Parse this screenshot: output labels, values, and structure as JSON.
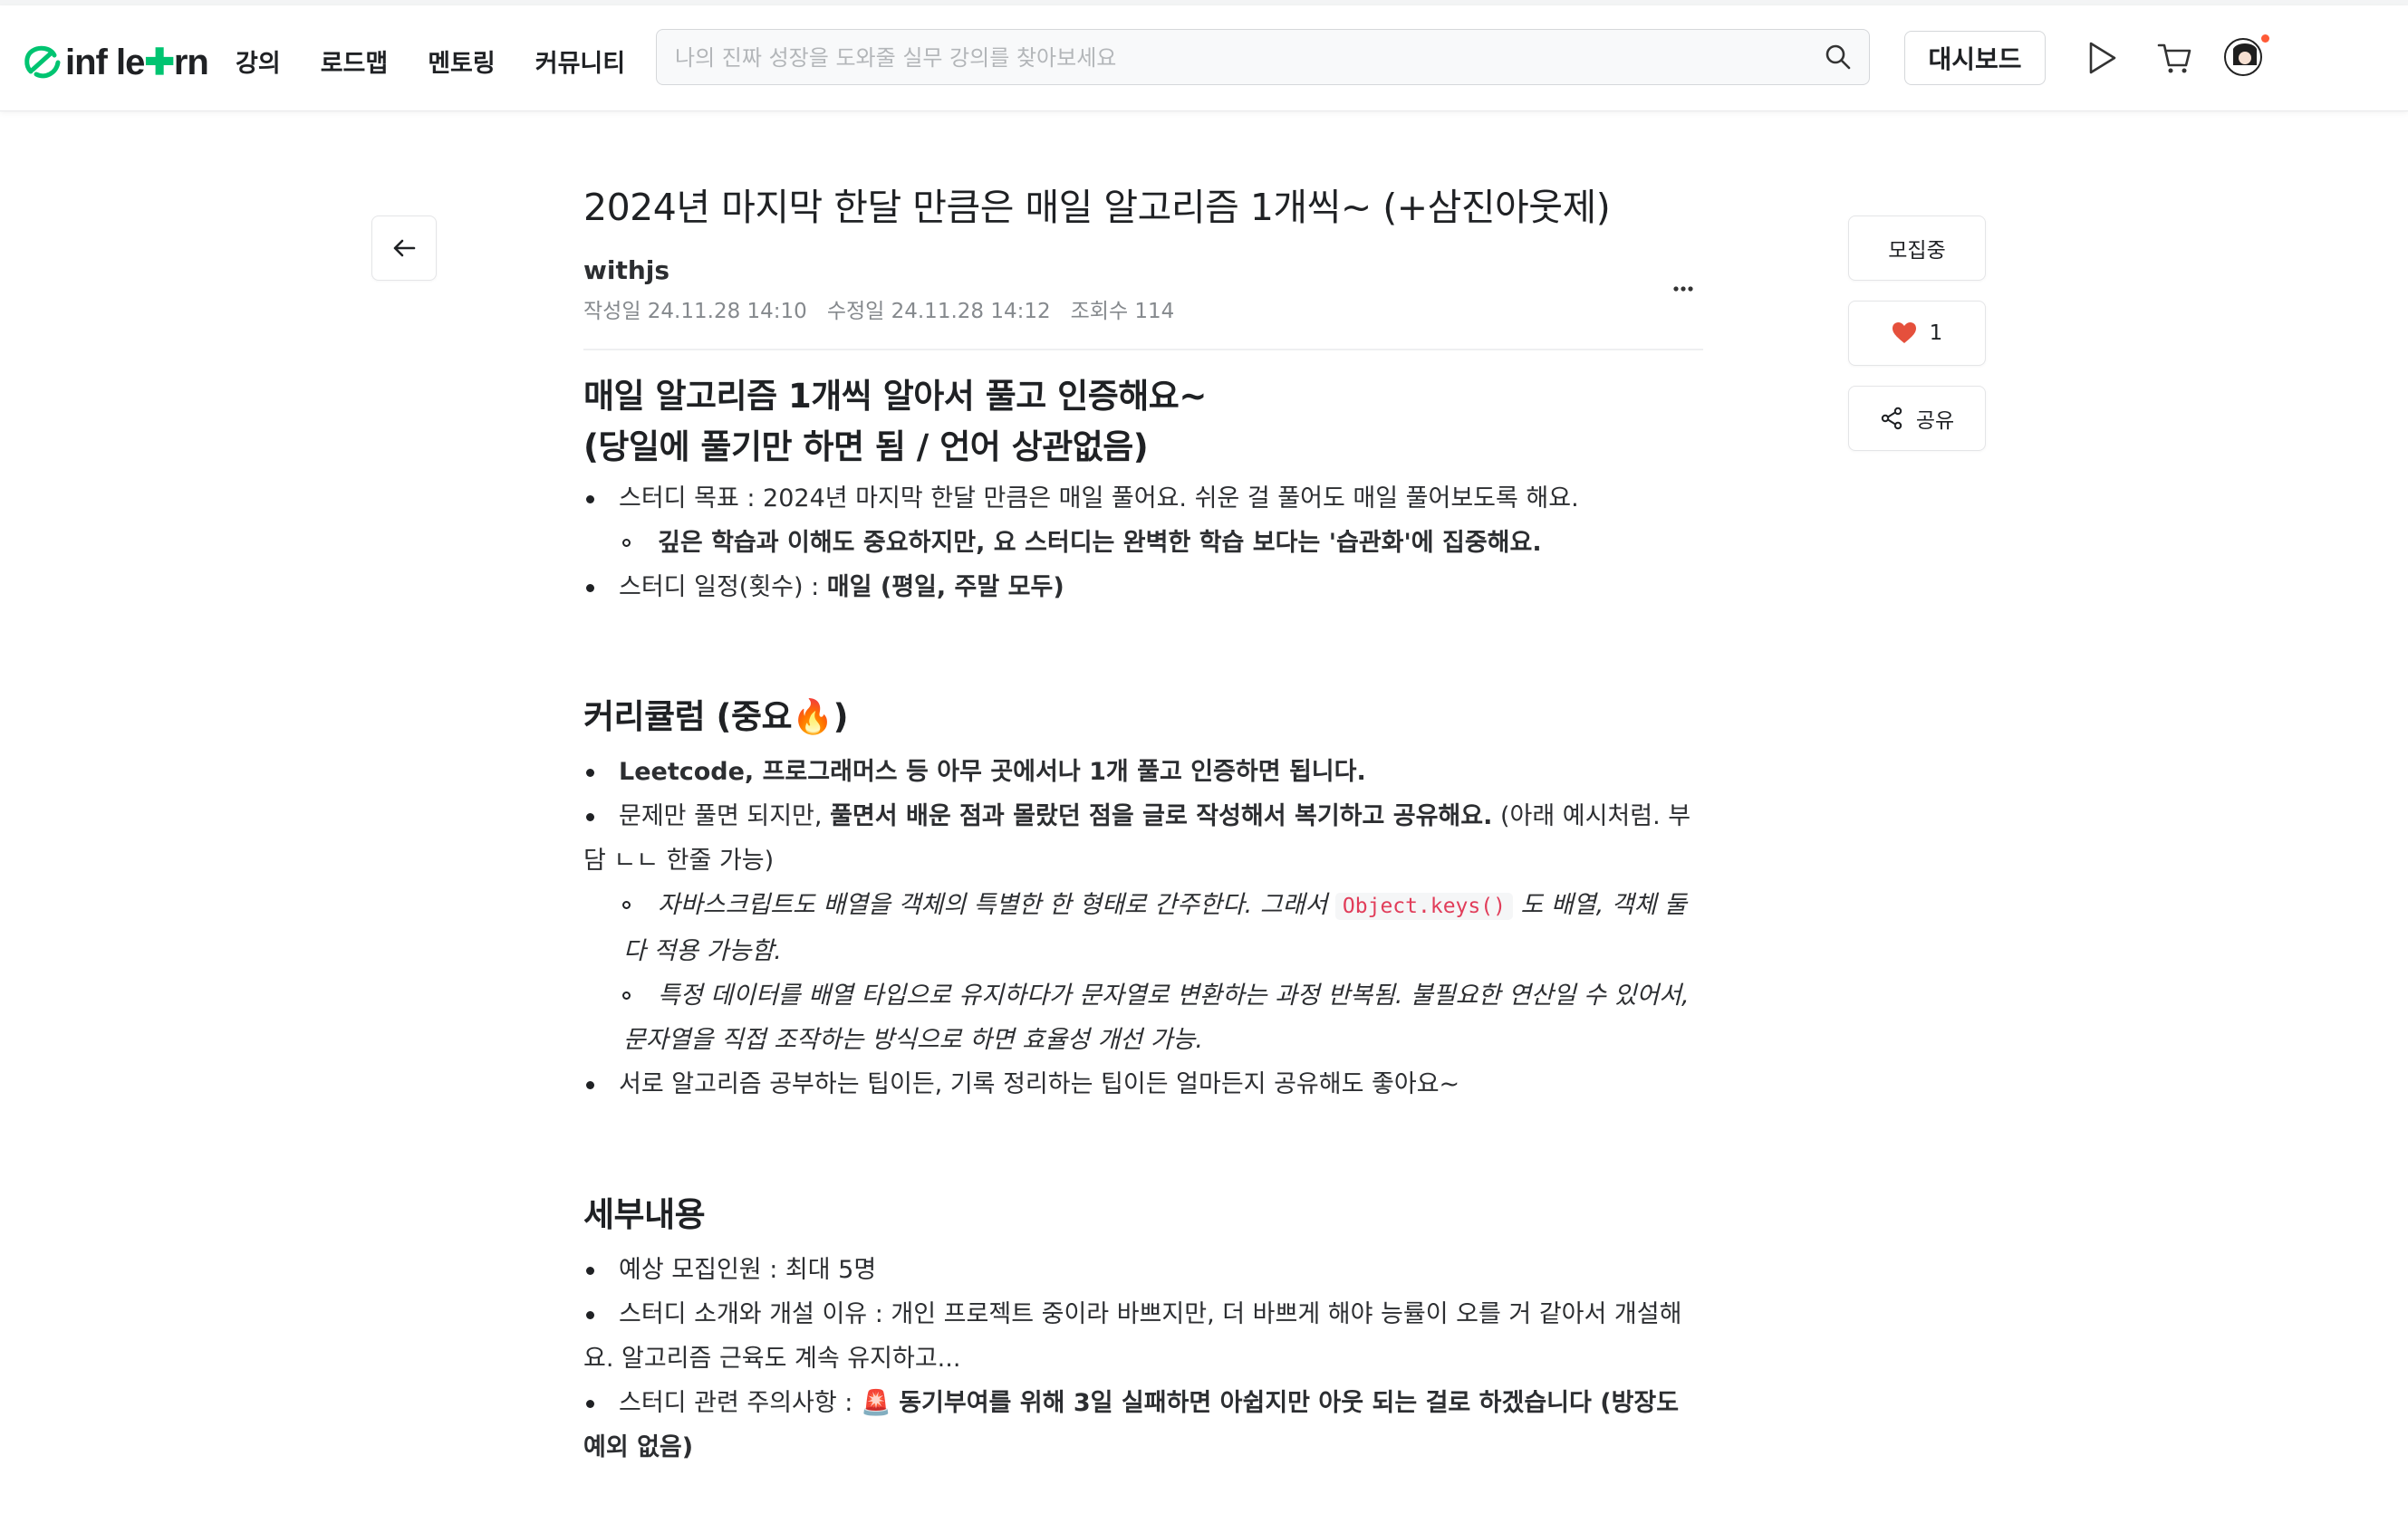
{
  "header": {
    "logo_text_pre": "inf le",
    "logo_text_post": "rn",
    "nav": [
      "강의",
      "로드맵",
      "멘토링",
      "커뮤니티"
    ],
    "search_placeholder": "나의 진짜 성장을 도와줄 실무 강의를 찾아보세요",
    "dashboard_label": "대시보드"
  },
  "post": {
    "title": "2024년 마지막 한달 만큼은 매일 알고리즘 1개씩~ (+삼진아웃제)",
    "author": "withjs",
    "created": "작성일 24.11.28 14:10",
    "modified": "수정일 24.11.28 14:12",
    "views": "조회수 114"
  },
  "actions": {
    "status": "모집중",
    "likes": "1",
    "share": "공유"
  },
  "content": {
    "heading1_line1": "매일 알고리즘 1개씩 알아서 풀고 인증해요~",
    "heading1_line2": "(당일에 풀기만 하면 됨 / 언어 상관없음)",
    "goal": "스터디 목표 : 2024년 마지막 한달 만큼은 매일 풀어요. 쉬운 걸 풀어도 매일 풀어보도록 해요.",
    "goal_sub": "깊은 학습과 이해도 중요하지만, 요 스터디는 완벽한 학습 보다는 '습관화'에 집중해요.",
    "schedule_label": "스터디 일정(횟수) : ",
    "schedule_value": "매일 (평일, 주말 모두)",
    "heading2": "커리큘럼 (중요🔥)",
    "curr1": "Leetcode, 프로그래머스 등 아무 곳에서나 1개 풀고 인증하면 됩니다.",
    "curr2_pre": "문제만 풀면 되지만, ",
    "curr2_bold": "풀면서 배운 점과 몰랐던 점을 글로 작성해서 복기하고 공유해요.",
    "curr2_post": " (아래 예시처럼. 부담 ㄴㄴ 한줄 가능)",
    "ex1_pre": "자바스크립트도 배열을 객체의 특별한 한 형태로 간주한다. 그래서 ",
    "ex1_code": "Object.keys()",
    "ex1_post": " 도 배열, 객체 둘다 적용 가능함.",
    "ex2": "특정 데이터를 배열 타입으로 유지하다가 문자열로 변환하는 과정 반복됨. 불필요한 연산일 수 있어서, 문자열을 직접 조작하는 방식으로 하면 효율성 개선 가능.",
    "curr3": "서로 알고리즘 공부하는 팁이든, 기록 정리하는 팁이든 얼마든지 공유해도 좋아요~",
    "heading3": "세부내용",
    "detail1": "예상 모집인원 : 최대 5명",
    "detail2": "스터디 소개와 개설 이유 : 개인 프로젝트 중이라 바쁘지만, 더 바쁘게 해야 능률이 오를 거 같아서 개설해요. 알고리즘 근육도 계속 유지하고...",
    "detail3_pre": "스터디 관련 주의사항 : 🚨 ",
    "detail3_bold": "동기부여를 위해 3일 실패하면 아쉽지만 아웃 되는 걸로 하겠습니다 (방장도 예외 없음)"
  }
}
